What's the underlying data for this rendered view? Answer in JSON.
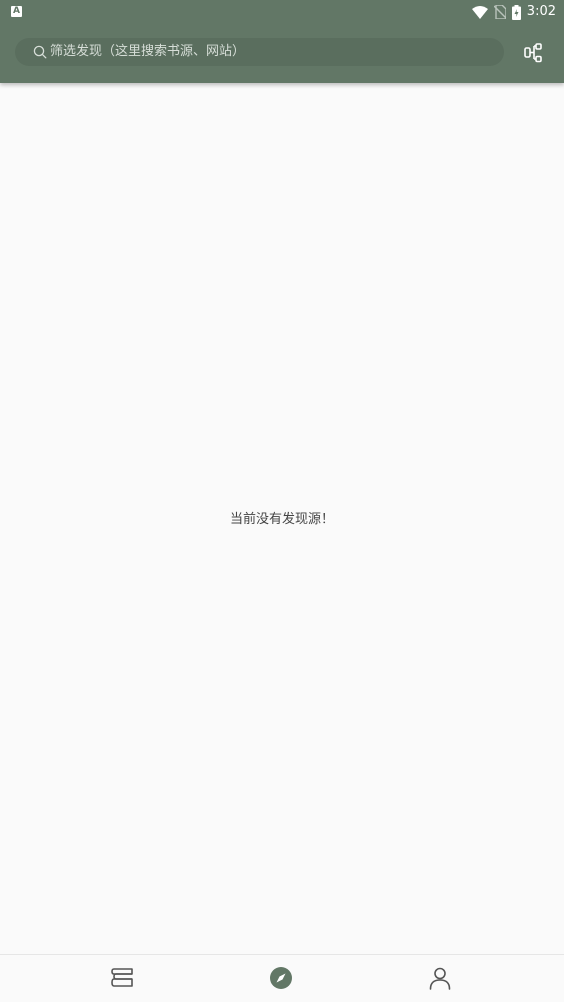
{
  "status_bar": {
    "app_icon": "text-a-icon",
    "time": "3:02",
    "icons": [
      "wifi-icon",
      "no-sim-icon",
      "battery-charging-icon"
    ]
  },
  "search": {
    "placeholder": "筛选发现（这里搜索书源、网站）",
    "icon": "search-icon"
  },
  "toolbar": {
    "config_icon": "flow-config-icon"
  },
  "main": {
    "empty_message": "当前没有发现源！"
  },
  "bottom_nav": {
    "items": [
      {
        "icon": "bookshelf-icon",
        "active": false
      },
      {
        "icon": "compass-icon",
        "active": true
      },
      {
        "icon": "person-icon",
        "active": false
      }
    ]
  },
  "colors": {
    "accent": "#627766",
    "search_background": "#5a6e5e",
    "background": "#fafafa",
    "inactive_icon": "#555555"
  }
}
